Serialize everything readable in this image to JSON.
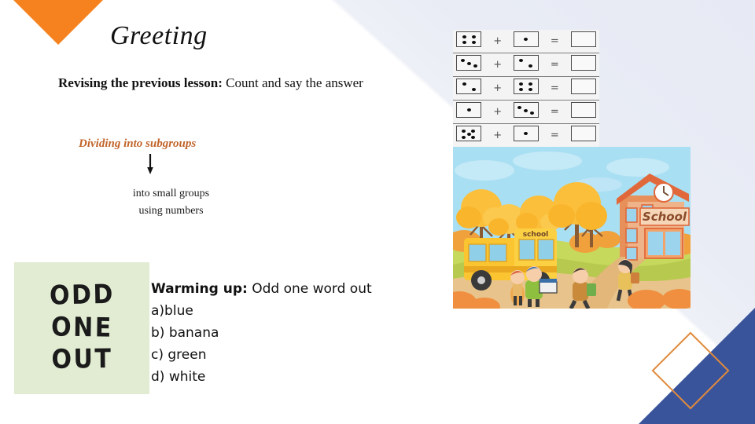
{
  "slide": {
    "title": "Greeting",
    "revising_label": "Revising the previous lesson:",
    "revising_text": " Count and say the answer",
    "subgroups_title": "Dividing into subgroups",
    "subgroups_detail_line1": "into small groups",
    "subgroups_detail_line2": "using numbers"
  },
  "colors": {
    "orange_triangle": "#f5821f",
    "blue_triangle": "#3a549c",
    "diamond_outline": "#e08a3c",
    "subgroups_heading": "#c1642a",
    "green_card": "#e1ecd2",
    "background_band": "#e7eaf4"
  },
  "odd_card": {
    "line1": "ODD",
    "line2": "ONE",
    "line3": "OUT"
  },
  "warming": {
    "heading": "Warming up:",
    "prompt": " Odd one word out",
    "options": [
      "a)blue",
      "b) banana",
      "c) green",
      "d) white"
    ]
  },
  "dice_table": {
    "plus_symbol": "+",
    "equals_symbol": "=",
    "rows": [
      {
        "left_dots": 4,
        "left_pattern": "grid4",
        "right_dots": 1,
        "right_pattern": "center1",
        "answer": ""
      },
      {
        "left_dots": 3,
        "left_pattern": "diag3",
        "right_dots": 2,
        "right_pattern": "diag2",
        "answer": ""
      },
      {
        "left_dots": 2,
        "left_pattern": "diag2",
        "right_dots": 4,
        "right_pattern": "grid4",
        "answer": ""
      },
      {
        "left_dots": 1,
        "left_pattern": "center1",
        "right_dots": 3,
        "right_pattern": "diag3",
        "answer": ""
      },
      {
        "left_dots": 5,
        "left_pattern": "quinc5",
        "right_dots": 1,
        "right_pattern": "center1",
        "answer": ""
      }
    ]
  },
  "school_image": {
    "bus_label": "school",
    "building_label": "School",
    "alt": "Cartoon autumn scene with children walking to school, a yellow school bus and orange trees"
  }
}
